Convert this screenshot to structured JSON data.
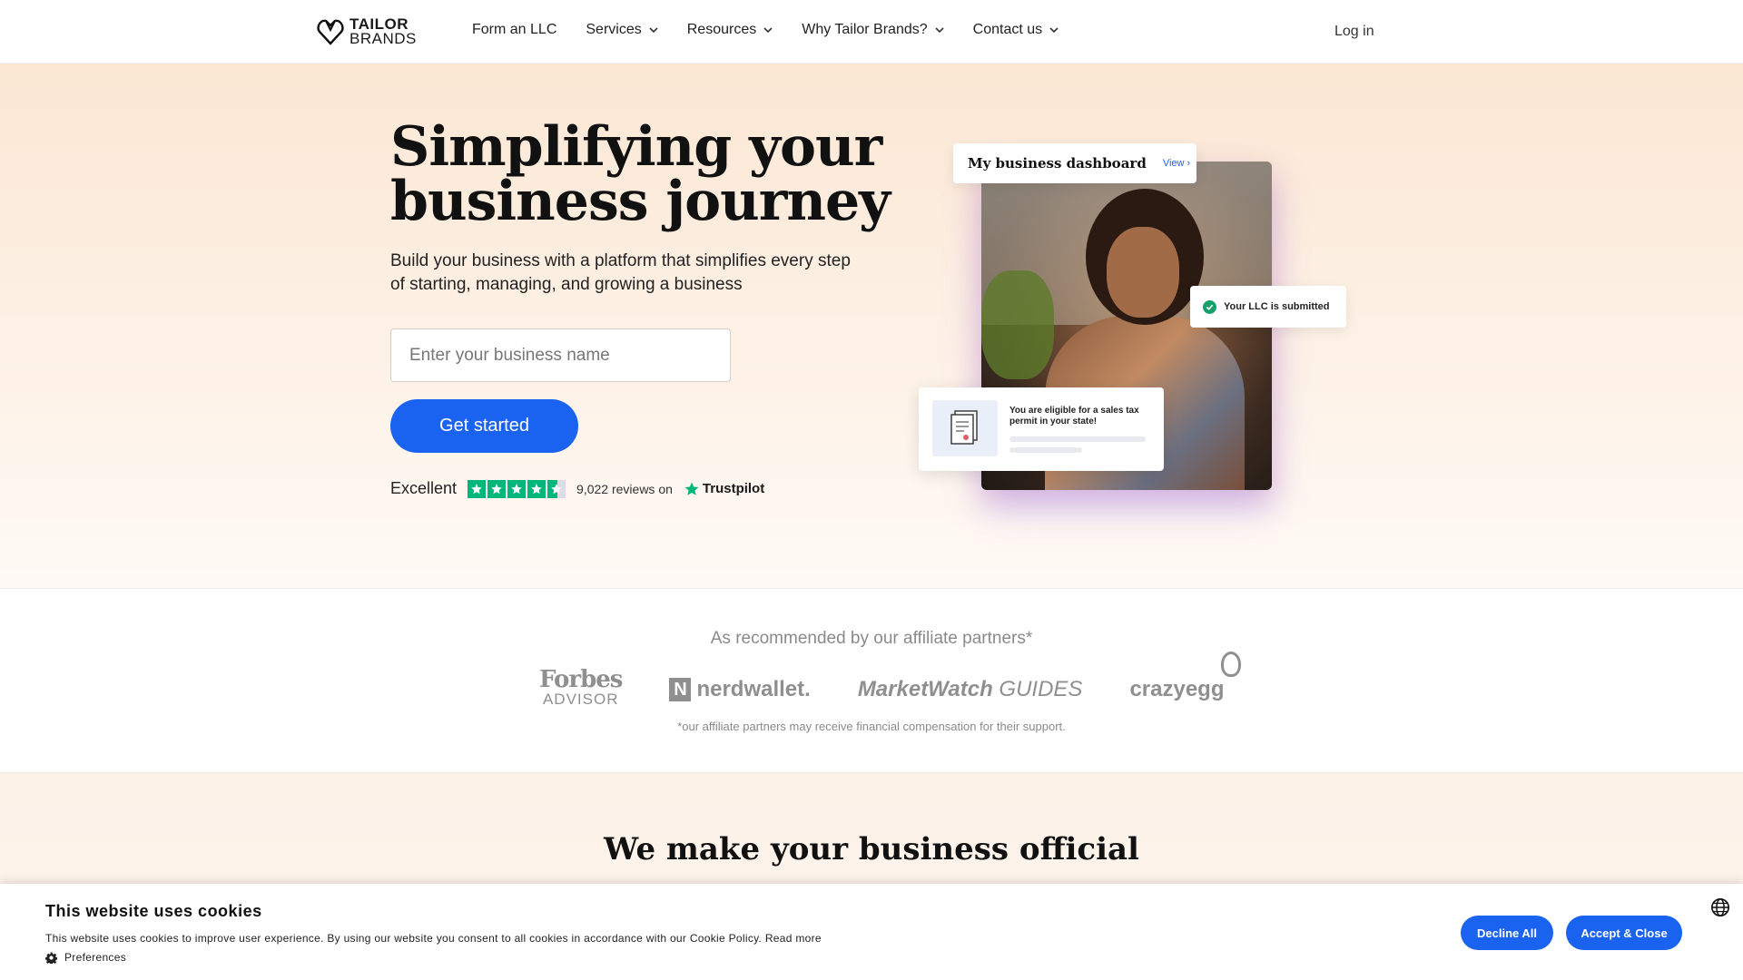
{
  "nav": {
    "logo": {
      "line1": "TAILOR",
      "line2": "BRANDS"
    },
    "links": [
      {
        "label": "Form an LLC",
        "has_dropdown": false
      },
      {
        "label": "Services",
        "has_dropdown": true
      },
      {
        "label": "Resources",
        "has_dropdown": true
      },
      {
        "label": "Why Tailor Brands?",
        "has_dropdown": true
      },
      {
        "label": "Contact us",
        "has_dropdown": true
      }
    ],
    "login": "Log in"
  },
  "hero": {
    "title": "Simplifying your business journey",
    "subtitle": "Build your business with a platform that simplifies every step of starting, managing, and growing a business",
    "input_placeholder": "Enter your business name",
    "cta": "Get started",
    "trustpilot": {
      "rating_word": "Excellent",
      "stars": 4.5,
      "reviews": "9,022 reviews on",
      "brand": "Trustpilot"
    },
    "dashboard_card": {
      "title": "My business dashboard",
      "link": "View ›"
    },
    "llc_card": "Your LLC is submitted",
    "permit_card": "You are eligible for a sales tax permit in your state!"
  },
  "partners": {
    "heading": "As recommended by our affiliate partners*",
    "logos": {
      "forbes_line1": "Forbes",
      "forbes_line2": "ADVISOR",
      "nerdwallet": "nerdwallet.",
      "marketwatch": "MarketWatch",
      "marketwatch_guides": "GUIDES",
      "crazyegg": "crazyegg"
    },
    "note": "*our affiliate partners may receive financial compensation for their support."
  },
  "section2": {
    "title": "We make your business official"
  },
  "cookie": {
    "title": "This website uses cookies",
    "text": "This website uses cookies to improve user experience. By using our website you consent to all cookies in accordance with our Cookie Policy.",
    "read_more": "Read more",
    "preferences": "Preferences",
    "decline": "Decline All",
    "accept": "Accept & Close"
  },
  "colors": {
    "accent": "#1a63f0",
    "trustpilot_green": "#00b67a",
    "hero_bg": "#fbe7d4"
  }
}
